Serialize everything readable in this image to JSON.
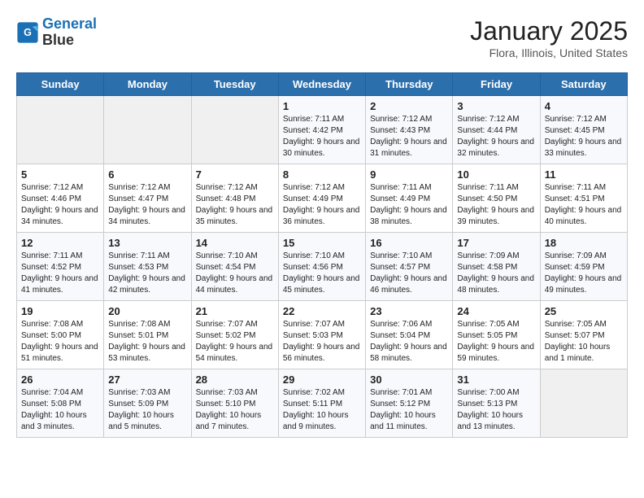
{
  "header": {
    "logo_line1": "General",
    "logo_line2": "Blue",
    "title": "January 2025",
    "subtitle": "Flora, Illinois, United States"
  },
  "weekdays": [
    "Sunday",
    "Monday",
    "Tuesday",
    "Wednesday",
    "Thursday",
    "Friday",
    "Saturday"
  ],
  "weeks": [
    [
      {
        "day": "",
        "sunrise": "",
        "sunset": "",
        "daylight": "",
        "empty": true
      },
      {
        "day": "",
        "sunrise": "",
        "sunset": "",
        "daylight": "",
        "empty": true
      },
      {
        "day": "",
        "sunrise": "",
        "sunset": "",
        "daylight": "",
        "empty": true
      },
      {
        "day": "1",
        "sunrise": "Sunrise: 7:11 AM",
        "sunset": "Sunset: 4:42 PM",
        "daylight": "Daylight: 9 hours and 30 minutes."
      },
      {
        "day": "2",
        "sunrise": "Sunrise: 7:12 AM",
        "sunset": "Sunset: 4:43 PM",
        "daylight": "Daylight: 9 hours and 31 minutes."
      },
      {
        "day": "3",
        "sunrise": "Sunrise: 7:12 AM",
        "sunset": "Sunset: 4:44 PM",
        "daylight": "Daylight: 9 hours and 32 minutes."
      },
      {
        "day": "4",
        "sunrise": "Sunrise: 7:12 AM",
        "sunset": "Sunset: 4:45 PM",
        "daylight": "Daylight: 9 hours and 33 minutes."
      }
    ],
    [
      {
        "day": "5",
        "sunrise": "Sunrise: 7:12 AM",
        "sunset": "Sunset: 4:46 PM",
        "daylight": "Daylight: 9 hours and 34 minutes."
      },
      {
        "day": "6",
        "sunrise": "Sunrise: 7:12 AM",
        "sunset": "Sunset: 4:47 PM",
        "daylight": "Daylight: 9 hours and 34 minutes."
      },
      {
        "day": "7",
        "sunrise": "Sunrise: 7:12 AM",
        "sunset": "Sunset: 4:48 PM",
        "daylight": "Daylight: 9 hours and 35 minutes."
      },
      {
        "day": "8",
        "sunrise": "Sunrise: 7:12 AM",
        "sunset": "Sunset: 4:49 PM",
        "daylight": "Daylight: 9 hours and 36 minutes."
      },
      {
        "day": "9",
        "sunrise": "Sunrise: 7:11 AM",
        "sunset": "Sunset: 4:49 PM",
        "daylight": "Daylight: 9 hours and 38 minutes."
      },
      {
        "day": "10",
        "sunrise": "Sunrise: 7:11 AM",
        "sunset": "Sunset: 4:50 PM",
        "daylight": "Daylight: 9 hours and 39 minutes."
      },
      {
        "day": "11",
        "sunrise": "Sunrise: 7:11 AM",
        "sunset": "Sunset: 4:51 PM",
        "daylight": "Daylight: 9 hours and 40 minutes."
      }
    ],
    [
      {
        "day": "12",
        "sunrise": "Sunrise: 7:11 AM",
        "sunset": "Sunset: 4:52 PM",
        "daylight": "Daylight: 9 hours and 41 minutes."
      },
      {
        "day": "13",
        "sunrise": "Sunrise: 7:11 AM",
        "sunset": "Sunset: 4:53 PM",
        "daylight": "Daylight: 9 hours and 42 minutes."
      },
      {
        "day": "14",
        "sunrise": "Sunrise: 7:10 AM",
        "sunset": "Sunset: 4:54 PM",
        "daylight": "Daylight: 9 hours and 44 minutes."
      },
      {
        "day": "15",
        "sunrise": "Sunrise: 7:10 AM",
        "sunset": "Sunset: 4:56 PM",
        "daylight": "Daylight: 9 hours and 45 minutes."
      },
      {
        "day": "16",
        "sunrise": "Sunrise: 7:10 AM",
        "sunset": "Sunset: 4:57 PM",
        "daylight": "Daylight: 9 hours and 46 minutes."
      },
      {
        "day": "17",
        "sunrise": "Sunrise: 7:09 AM",
        "sunset": "Sunset: 4:58 PM",
        "daylight": "Daylight: 9 hours and 48 minutes."
      },
      {
        "day": "18",
        "sunrise": "Sunrise: 7:09 AM",
        "sunset": "Sunset: 4:59 PM",
        "daylight": "Daylight: 9 hours and 49 minutes."
      }
    ],
    [
      {
        "day": "19",
        "sunrise": "Sunrise: 7:08 AM",
        "sunset": "Sunset: 5:00 PM",
        "daylight": "Daylight: 9 hours and 51 minutes."
      },
      {
        "day": "20",
        "sunrise": "Sunrise: 7:08 AM",
        "sunset": "Sunset: 5:01 PM",
        "daylight": "Daylight: 9 hours and 53 minutes."
      },
      {
        "day": "21",
        "sunrise": "Sunrise: 7:07 AM",
        "sunset": "Sunset: 5:02 PM",
        "daylight": "Daylight: 9 hours and 54 minutes."
      },
      {
        "day": "22",
        "sunrise": "Sunrise: 7:07 AM",
        "sunset": "Sunset: 5:03 PM",
        "daylight": "Daylight: 9 hours and 56 minutes."
      },
      {
        "day": "23",
        "sunrise": "Sunrise: 7:06 AM",
        "sunset": "Sunset: 5:04 PM",
        "daylight": "Daylight: 9 hours and 58 minutes."
      },
      {
        "day": "24",
        "sunrise": "Sunrise: 7:05 AM",
        "sunset": "Sunset: 5:05 PM",
        "daylight": "Daylight: 9 hours and 59 minutes."
      },
      {
        "day": "25",
        "sunrise": "Sunrise: 7:05 AM",
        "sunset": "Sunset: 5:07 PM",
        "daylight": "Daylight: 10 hours and 1 minute."
      }
    ],
    [
      {
        "day": "26",
        "sunrise": "Sunrise: 7:04 AM",
        "sunset": "Sunset: 5:08 PM",
        "daylight": "Daylight: 10 hours and 3 minutes."
      },
      {
        "day": "27",
        "sunrise": "Sunrise: 7:03 AM",
        "sunset": "Sunset: 5:09 PM",
        "daylight": "Daylight: 10 hours and 5 minutes."
      },
      {
        "day": "28",
        "sunrise": "Sunrise: 7:03 AM",
        "sunset": "Sunset: 5:10 PM",
        "daylight": "Daylight: 10 hours and 7 minutes."
      },
      {
        "day": "29",
        "sunrise": "Sunrise: 7:02 AM",
        "sunset": "Sunset: 5:11 PM",
        "daylight": "Daylight: 10 hours and 9 minutes."
      },
      {
        "day": "30",
        "sunrise": "Sunrise: 7:01 AM",
        "sunset": "Sunset: 5:12 PM",
        "daylight": "Daylight: 10 hours and 11 minutes."
      },
      {
        "day": "31",
        "sunrise": "Sunrise: 7:00 AM",
        "sunset": "Sunset: 5:13 PM",
        "daylight": "Daylight: 10 hours and 13 minutes."
      },
      {
        "day": "",
        "sunrise": "",
        "sunset": "",
        "daylight": "",
        "empty": true
      }
    ]
  ]
}
